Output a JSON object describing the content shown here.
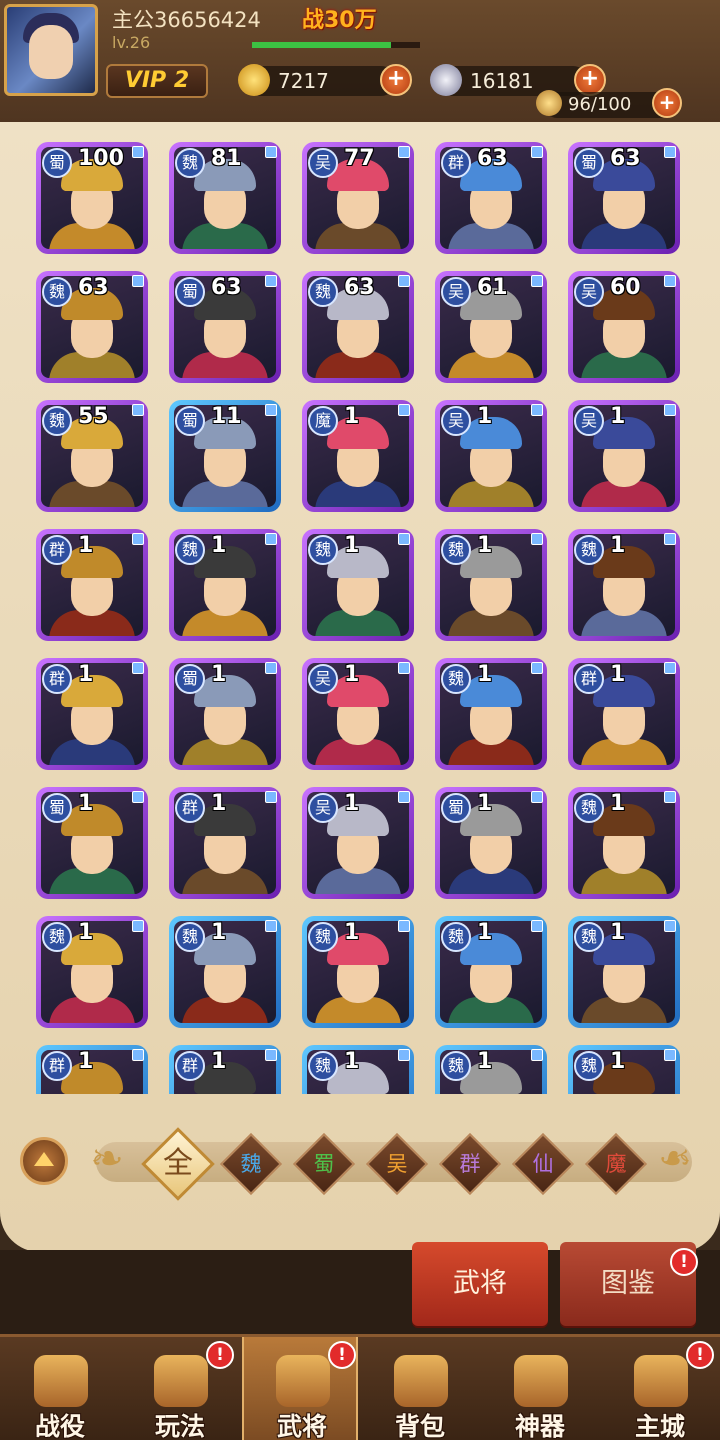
{
  "header": {
    "player_name": "主公36656424",
    "level": "lv.26",
    "power": "战30万",
    "exp_fraction": 0.83,
    "vip": "VIP 2",
    "gold": "7217",
    "silver": "16181",
    "stamina": "96/100"
  },
  "heroes": [
    {
      "faction": "蜀",
      "level": "100",
      "frame": "purple"
    },
    {
      "faction": "魏",
      "level": "81",
      "frame": "purple"
    },
    {
      "faction": "吴",
      "level": "77",
      "frame": "purple"
    },
    {
      "faction": "群",
      "level": "63",
      "frame": "purple"
    },
    {
      "faction": "蜀",
      "level": "63",
      "frame": "purple"
    },
    {
      "faction": "魏",
      "level": "63",
      "frame": "purple"
    },
    {
      "faction": "蜀",
      "level": "63",
      "frame": "purple"
    },
    {
      "faction": "魏",
      "level": "63",
      "frame": "purple"
    },
    {
      "faction": "吴",
      "level": "61",
      "frame": "purple"
    },
    {
      "faction": "吴",
      "level": "60",
      "frame": "purple"
    },
    {
      "faction": "魏",
      "level": "55",
      "frame": "purple"
    },
    {
      "faction": "蜀",
      "level": "11",
      "frame": "blue"
    },
    {
      "faction": "魔",
      "level": "1",
      "frame": "purple"
    },
    {
      "faction": "吴",
      "level": "1",
      "frame": "purple"
    },
    {
      "faction": "吴",
      "level": "1",
      "frame": "purple"
    },
    {
      "faction": "群",
      "level": "1",
      "frame": "purple"
    },
    {
      "faction": "魏",
      "level": "1",
      "frame": "purple"
    },
    {
      "faction": "魏",
      "level": "1",
      "frame": "purple"
    },
    {
      "faction": "魏",
      "level": "1",
      "frame": "purple"
    },
    {
      "faction": "魏",
      "level": "1",
      "frame": "purple"
    },
    {
      "faction": "群",
      "level": "1",
      "frame": "purple"
    },
    {
      "faction": "蜀",
      "level": "1",
      "frame": "purple"
    },
    {
      "faction": "吴",
      "level": "1",
      "frame": "purple"
    },
    {
      "faction": "魏",
      "level": "1",
      "frame": "purple"
    },
    {
      "faction": "群",
      "level": "1",
      "frame": "purple"
    },
    {
      "faction": "蜀",
      "level": "1",
      "frame": "purple"
    },
    {
      "faction": "群",
      "level": "1",
      "frame": "purple"
    },
    {
      "faction": "吴",
      "level": "1",
      "frame": "purple"
    },
    {
      "faction": "蜀",
      "level": "1",
      "frame": "purple"
    },
    {
      "faction": "魏",
      "level": "1",
      "frame": "purple"
    },
    {
      "faction": "魏",
      "level": "1",
      "frame": "purple"
    },
    {
      "faction": "魏",
      "level": "1",
      "frame": "blue"
    },
    {
      "faction": "魏",
      "level": "1",
      "frame": "blue"
    },
    {
      "faction": "魏",
      "level": "1",
      "frame": "blue"
    },
    {
      "faction": "魏",
      "level": "1",
      "frame": "blue"
    },
    {
      "faction": "群",
      "level": "1",
      "frame": "blue"
    },
    {
      "faction": "群",
      "level": "1",
      "frame": "blue"
    },
    {
      "faction": "魏",
      "level": "1",
      "frame": "blue"
    },
    {
      "faction": "魏",
      "level": "1",
      "frame": "blue"
    },
    {
      "faction": "魏",
      "level": "1",
      "frame": "blue"
    }
  ],
  "filters": [
    {
      "label": "全",
      "color": "#7a4a1c",
      "active": true
    },
    {
      "label": "魏",
      "color": "#4aa8e8"
    },
    {
      "label": "蜀",
      "color": "#4fc04a"
    },
    {
      "label": "吴",
      "color": "#f0a030"
    },
    {
      "label": "群",
      "color": "#b87ad8"
    },
    {
      "label": "仙",
      "color": "#b070e0"
    },
    {
      "label": "魔",
      "color": "#e04a3a"
    }
  ],
  "subtabs": {
    "heroes": "武将",
    "codex": "图鉴",
    "badge": "!"
  },
  "nav": [
    {
      "label": "战役",
      "icon": "crossed-swords-icon",
      "badge": false
    },
    {
      "label": "玩法",
      "icon": "gate-icon",
      "badge": true
    },
    {
      "label": "武将",
      "icon": "helmet-icon",
      "badge": true,
      "active": true
    },
    {
      "label": "背包",
      "icon": "bag-icon",
      "badge": false
    },
    {
      "label": "神器",
      "icon": "dragon-icon",
      "badge": false
    },
    {
      "label": "主城",
      "icon": "castle-icon",
      "badge": true
    }
  ],
  "badge_mark": "!",
  "colors": {
    "accent": "#d64a2c",
    "gold": "#ffcc33",
    "purple_frame": "#9b3fe0",
    "blue_frame": "#3a94e0"
  }
}
